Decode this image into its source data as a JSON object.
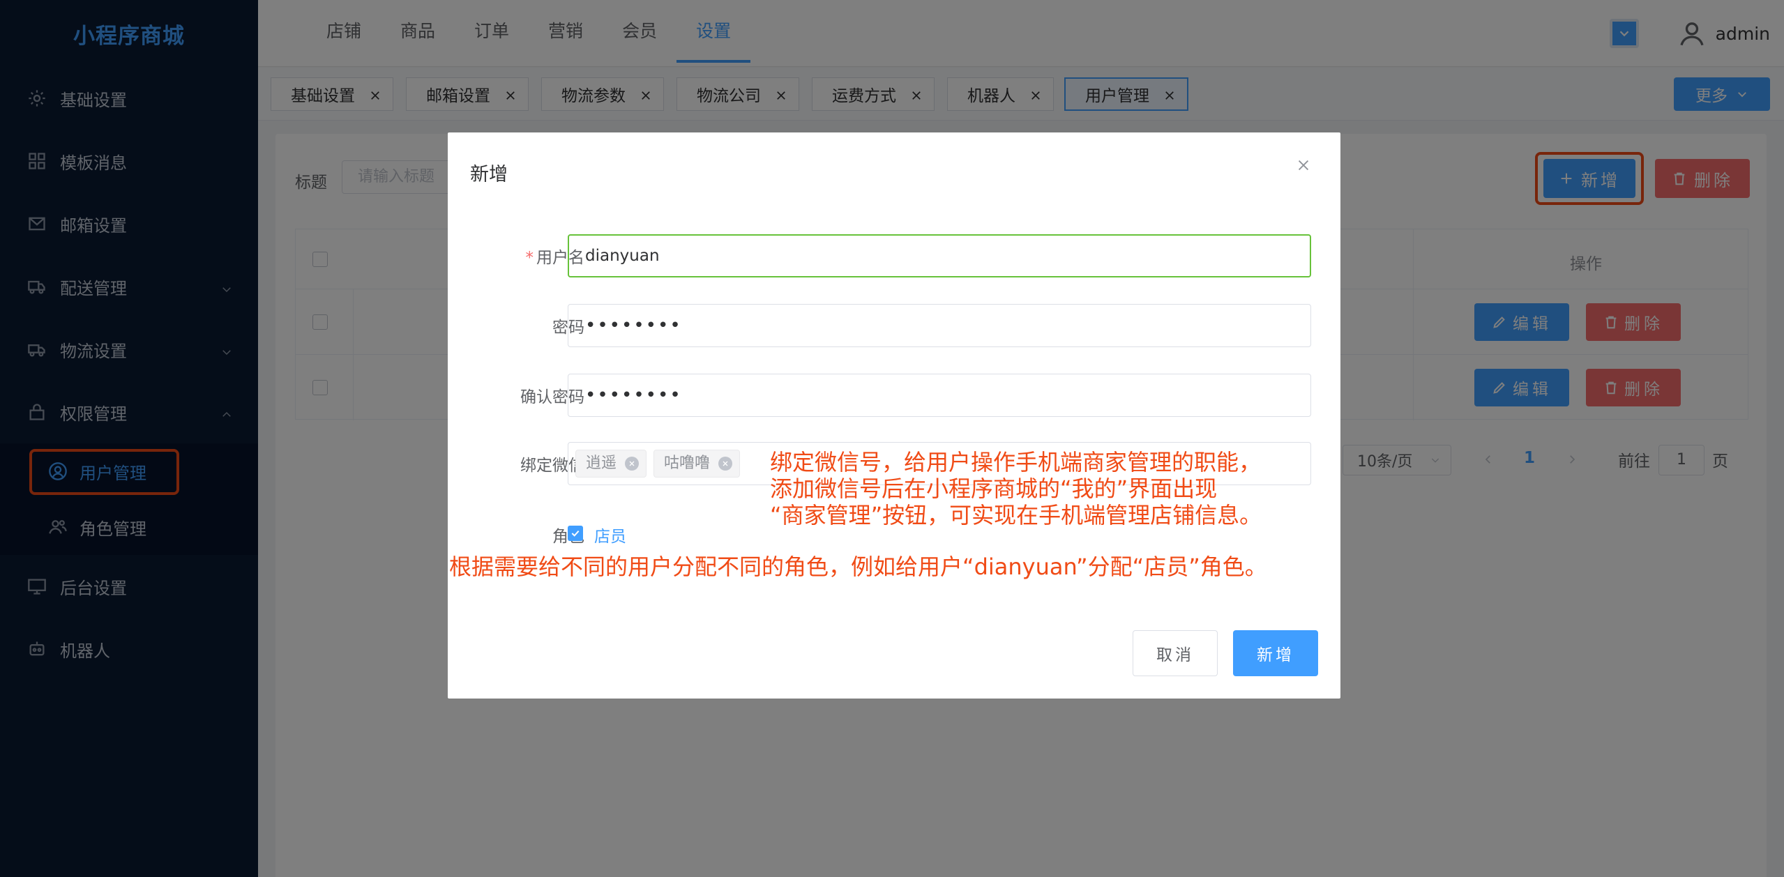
{
  "app": {
    "logo": "小程序商城"
  },
  "sidebar": {
    "items": [
      {
        "label": "基础设置",
        "icon": "gear-icon"
      },
      {
        "label": "模板消息",
        "icon": "grid-icon"
      },
      {
        "label": "邮箱设置",
        "icon": "mail-icon"
      },
      {
        "label": "配送管理",
        "icon": "truck-icon"
      },
      {
        "label": "物流设置",
        "icon": "delivery-truck-icon"
      },
      {
        "label": "权限管理",
        "icon": "lock-icon"
      },
      {
        "label": "后台设置",
        "icon": "monitor-icon"
      },
      {
        "label": "机器人",
        "icon": "robot-icon"
      }
    ],
    "subitems": [
      {
        "label": "用户管理",
        "icon": "user-circle-icon",
        "active": true
      },
      {
        "label": "角色管理",
        "icon": "users-icon",
        "active": false
      }
    ]
  },
  "topnav": {
    "items": [
      "店铺",
      "商品",
      "订单",
      "营销",
      "会员",
      "设置"
    ],
    "active": "设置"
  },
  "user": {
    "name": "admin"
  },
  "tags": [
    "基础设置",
    "邮箱设置",
    "物流参数",
    "物流公司",
    "运费方式",
    "机器人",
    "用户管理"
  ],
  "tags_active": "用户管理",
  "more_label": "更多",
  "search": {
    "label": "标题",
    "placeholder": "请输入标题"
  },
  "toolbar": {
    "add_label": "新增",
    "delete_label": "删除"
  },
  "table": {
    "op_header": "操作",
    "edit_label": "编辑",
    "delete_label": "删除"
  },
  "pager": {
    "page_size": "10条/页",
    "current": "1",
    "goto_prefix": "前往",
    "goto_value": "1",
    "goto_suffix": "页"
  },
  "dialog": {
    "title": "新增",
    "fields": {
      "username_label": "用户名",
      "username_value": "dianyuan",
      "password_label": "密码",
      "password_value": "••••••••",
      "confirm_label": "确认密码",
      "confirm_value": "••••••••",
      "wechat_label": "绑定微信",
      "wechat_tags": [
        "逍遥",
        "咕噜噜"
      ],
      "role_label": "角色",
      "role_value": "店员"
    },
    "cancel_label": "取消",
    "confirm_label": "新增"
  },
  "annotations": {
    "wechat_line1": "绑定微信号，给用户操作手机端商家管理的职能，",
    "wechat_line2": "添加微信号后在小程序商城的“我的”界面出现",
    "wechat_line3": "“商家管理”按钮，可实现在手机端管理店铺信息。",
    "role_note": "根据需要给不同的用户分配不同的角色，例如给用户“dianyuan”分配“店员”角色。"
  },
  "colors": {
    "primary": "#409eff",
    "danger": "#f56c6c",
    "annotation": "#f04b16",
    "sidebar_bg": "#0b1a33"
  }
}
